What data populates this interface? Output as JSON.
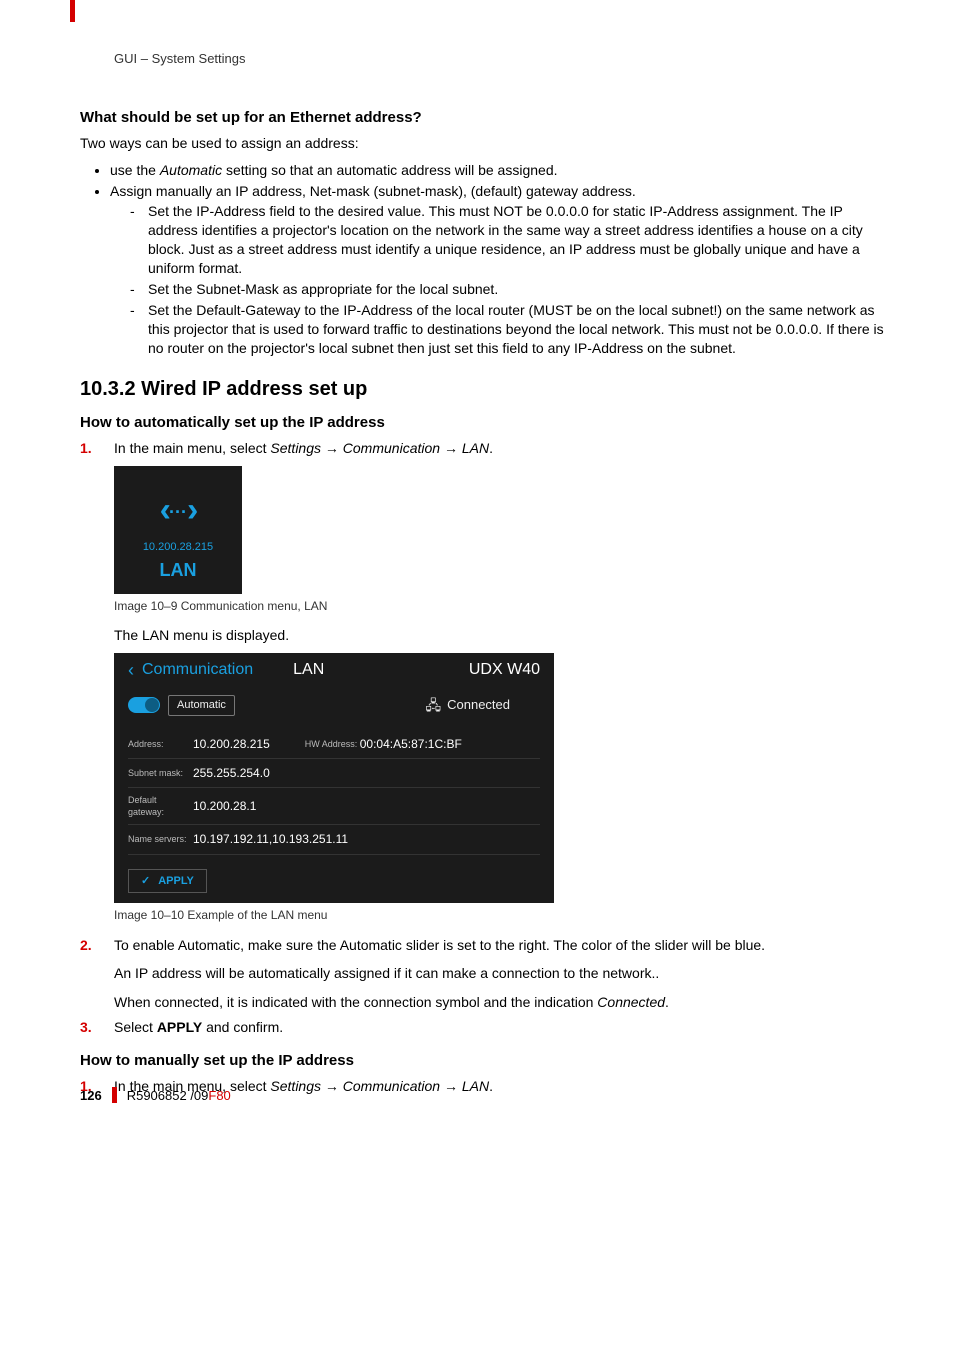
{
  "header": {
    "running": "GUI – System Settings"
  },
  "s1": {
    "title": "What should be set up for an Ethernet address?",
    "intro": "Two ways can be used to assign an address:",
    "b1_pre": "use the ",
    "b1_em": "Automatic",
    "b1_post": " setting so that an automatic address will be assigned.",
    "b2": "Assign manually an IP address, Net-mask (subnet-mask), (default) gateway address.",
    "d1": "Set the IP-Address field to the desired value. This must NOT be 0.0.0.0 for static IP-Address assignment. The IP address identifies a projector's location on the network in the same way a street address identifies a house on a city block. Just as a street address must identify a unique residence, an IP address must be globally unique and have a uniform format.",
    "d2": "Set the Subnet-Mask as appropriate for the local subnet.",
    "d3": "Set the Default-Gateway to the IP-Address of the local router (MUST be on the local subnet!) on the same network as this projector that is used to forward traffic to destinations beyond the local network. This must not be 0.0.0.0. If there is no router on the projector's local subnet then just set this field to any IP-Address on the subnet."
  },
  "s2": {
    "h": "10.3.2 Wired IP address set up",
    "sub1": "How to automatically set up the IP address",
    "step1_pre": "In the main menu, select ",
    "step1_em": "Settings → Communication → LAN",
    "step1_post": ".",
    "fig1_ip": "10.200.28.215",
    "fig1_lan": "LAN",
    "fig1_cap": "Image 10–9  Communication menu, LAN",
    "displayed": "The LAN menu is displayed.",
    "lan_menu": {
      "crumb": "Communication",
      "title": "LAN",
      "model": "UDX W40",
      "auto_label": "Automatic",
      "connected": "Connected",
      "rows": {
        "addr_l": "Address:",
        "addr_v": "10.200.28.215",
        "hw_l": "HW Address:",
        "hw_v": "00:04:A5:87:1C:BF",
        "mask_l": "Subnet mask:",
        "mask_v": "255.255.254.0",
        "gw_l": "Default gateway:",
        "gw_v": "10.200.28.1",
        "ns_l": "Name servers:",
        "ns_v": "10.197.192.11,10.193.251.11"
      },
      "apply": "APPLY"
    },
    "fig2_cap": "Image 10–10  Example of the LAN menu",
    "step2a": "To enable Automatic, make sure the Automatic slider is set to the right. The color of the slider will be blue.",
    "step2b": "An IP address will be automatically assigned if it can make a connection to the network..",
    "step2c_pre": "When connected, it is indicated with the connection symbol and the indication ",
    "step2c_em": "Connected",
    "step2c_post": ".",
    "step3_pre": "Select ",
    "step3_b": "APPLY",
    "step3_post": " and confirm.",
    "sub2": "How to manually set up the IP address",
    "m_step1_pre": "In the main menu, select ",
    "m_step1_em": "Settings → Communication → LAN",
    "m_step1_post": "."
  },
  "footer": {
    "page": "126",
    "doc": "R5906852 /09 ",
    "model": "F80"
  },
  "nums": {
    "n1": "1.",
    "n2": "2.",
    "n3": "3."
  }
}
